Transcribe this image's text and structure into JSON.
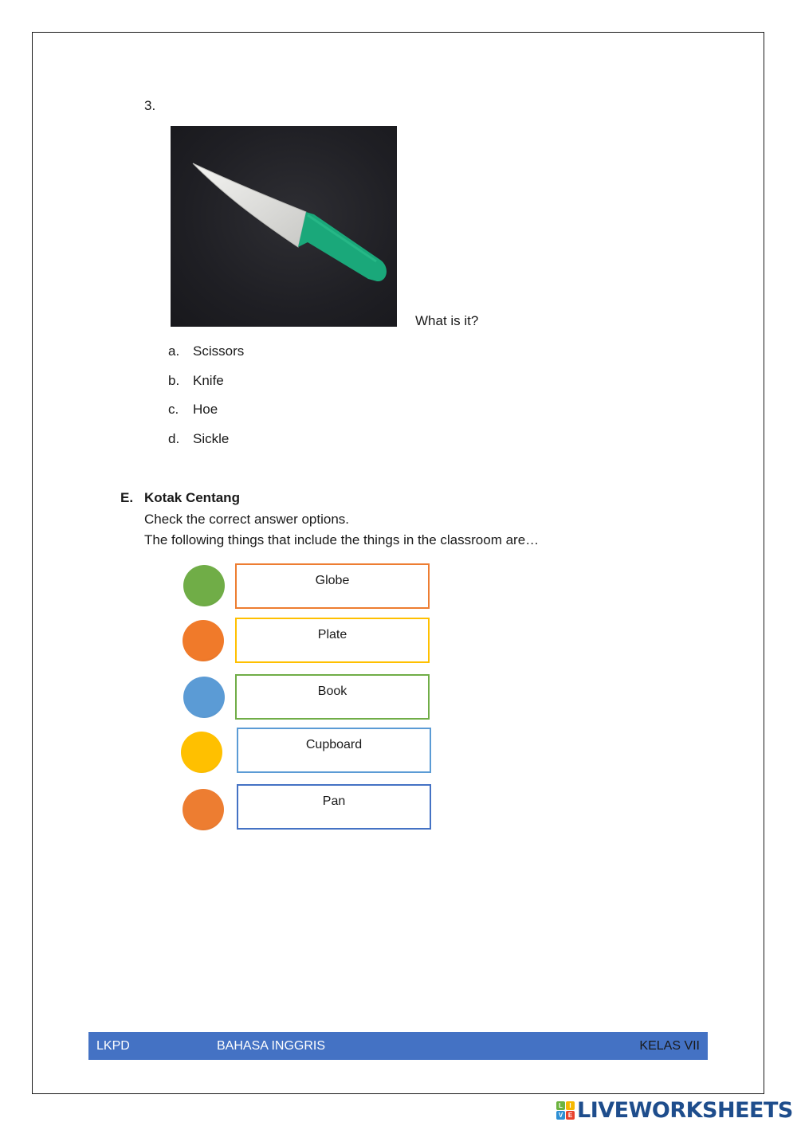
{
  "question": {
    "number": "3.",
    "image_alt": "knife with green handle on dark background",
    "prompt": "What is it?",
    "options": [
      {
        "letter": "a.",
        "text": "Scissors"
      },
      {
        "letter": "b.",
        "text": "Knife"
      },
      {
        "letter": "c.",
        "text": "Hoe"
      },
      {
        "letter": "d.",
        "text": "Sickle"
      }
    ]
  },
  "section": {
    "letter": "E.",
    "title": "Kotak Centang",
    "instruction": "Check the correct answer options.",
    "prompt": "The following things that include the things in the classroom are…",
    "choices": [
      {
        "label": "Globe",
        "dot_color": "#70ad47",
        "border_color": "#ed7d31"
      },
      {
        "label": "Plate",
        "dot_color": "#f07a2a",
        "border_color": "#ffc000"
      },
      {
        "label": "Book",
        "dot_color": "#5b9bd5",
        "border_color": "#70ad47"
      },
      {
        "label": "Cupboard",
        "dot_color": "#ffc000",
        "border_color": "#5b9bd5"
      },
      {
        "label": "Pan",
        "dot_color": "#ed7d31",
        "border_color": "#4472c4"
      }
    ]
  },
  "footer": {
    "left": "LKPD",
    "center": "BAHASA INGGRIS",
    "right": "KELAS VII",
    "color": "#4472c4"
  },
  "branding": {
    "logo_letters": [
      "L",
      "I",
      "V",
      "E"
    ],
    "logo_colors": [
      "#6cb33f",
      "#f5b800",
      "#2e8fd4",
      "#e8412c"
    ],
    "text": "LIVEWORKSHEETS"
  }
}
